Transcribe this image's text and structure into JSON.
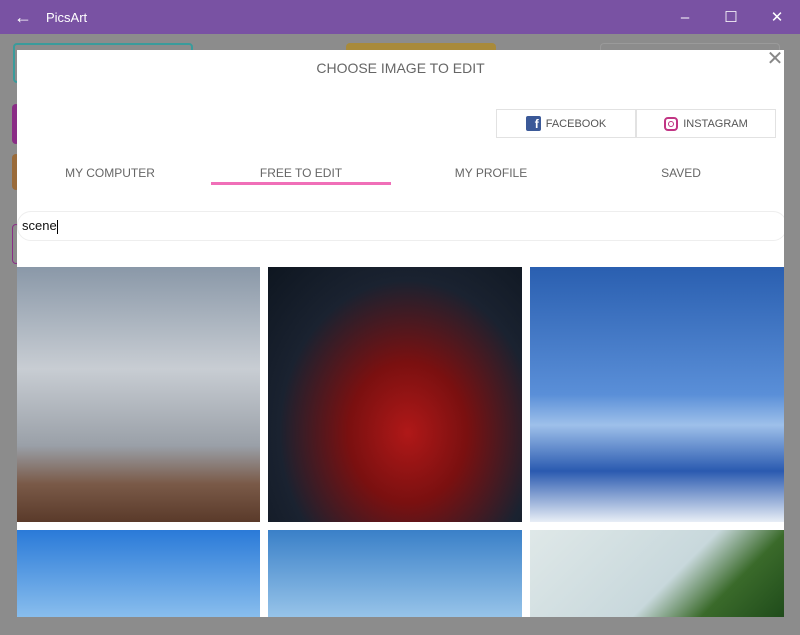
{
  "window": {
    "title": "PicsArt",
    "back_icon": "arrow-left-icon"
  },
  "dialog": {
    "title": "CHOOSE IMAGE TO EDIT",
    "social": [
      {
        "label": "FACEBOOK",
        "icon": "facebook-icon"
      },
      {
        "label": "INSTAGRAM",
        "icon": "instagram-icon"
      }
    ],
    "tabs": [
      {
        "label": "MY COMPUTER"
      },
      {
        "label": "FREE TO EDIT",
        "active": true
      },
      {
        "label": "MY PROFILE"
      },
      {
        "label": "SAVED"
      }
    ],
    "search": {
      "value": "scene"
    },
    "accent": "#f06fb8"
  },
  "colors": {
    "titlebar": "#7952a3"
  }
}
